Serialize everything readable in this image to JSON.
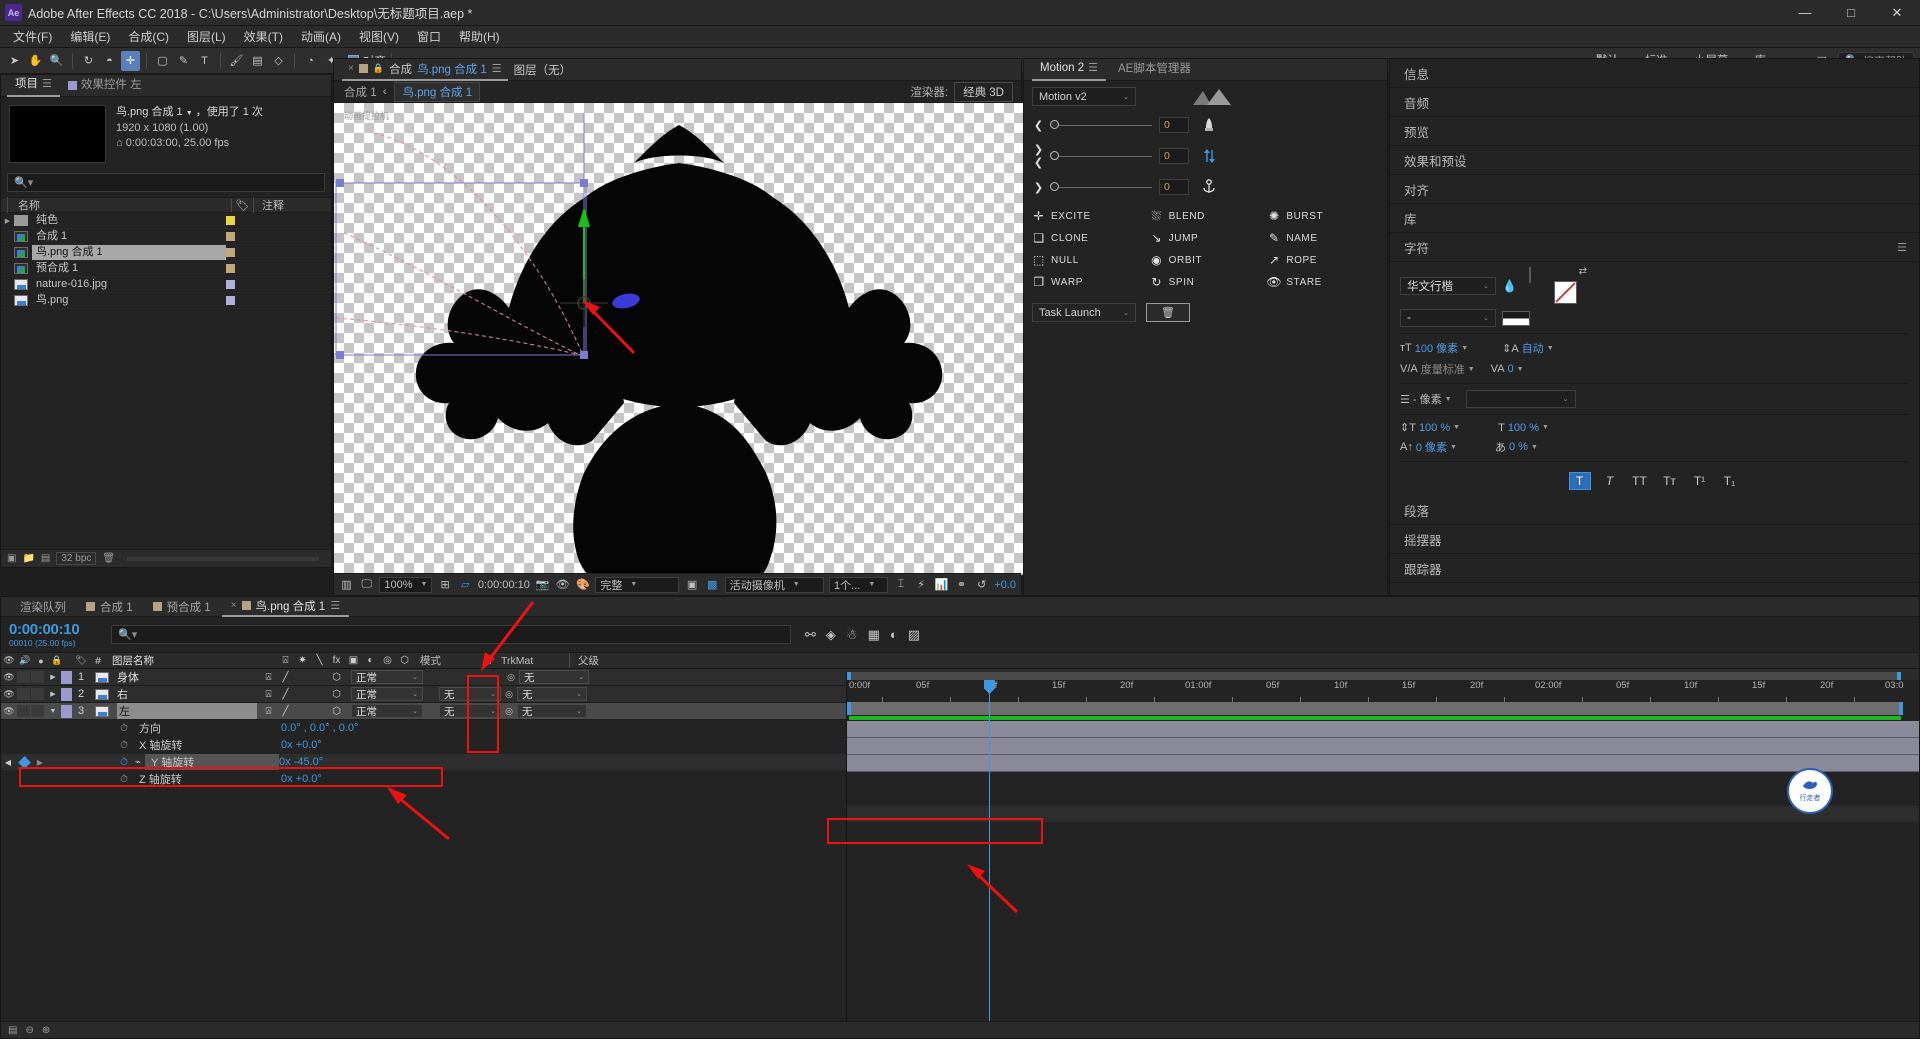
{
  "titlebar": {
    "logo": "Ae",
    "title": "Adobe After Effects CC 2018 - C:\\Users\\Administrator\\Desktop\\无标题项目.aep *",
    "minimize": "—",
    "maximize": "□",
    "close": "✕"
  },
  "menubar": {
    "items": [
      "文件(F)",
      "编辑(E)",
      "合成(C)",
      "图层(L)",
      "效果(T)",
      "动画(A)",
      "视图(V)",
      "窗口",
      "帮助(H)"
    ]
  },
  "toolbar": {
    "snap_label": "对齐",
    "workspaces": [
      "默认",
      "标准",
      "小屏幕",
      "库"
    ],
    "workspace_more": "»",
    "search_placeholder": "搜索帮助",
    "search_icon": "search-icon"
  },
  "project": {
    "tabs": [
      {
        "label": "项目",
        "active": true
      },
      {
        "label": "效果控件 左",
        "active": false
      }
    ],
    "info": {
      "name": "鸟.png 合成 1",
      "usage": "，使用了 1 次",
      "dimensions": "1920 x 1080 (1.00)",
      "duration": "0:00:03:00, 25.00 fps"
    },
    "search_placeholder": "",
    "columns": [
      "名称",
      "注释"
    ],
    "items": [
      {
        "name": "纯色",
        "type": "folder",
        "color": "#e8d64a",
        "expandable": true,
        "selected": false
      },
      {
        "name": "合成 1",
        "type": "comp",
        "color": "#c0a878",
        "expandable": false,
        "selected": false
      },
      {
        "name": "鸟.png 合成 1",
        "type": "comp",
        "color": "#c0a878",
        "expandable": false,
        "selected": true
      },
      {
        "name": "预合成 1",
        "type": "comp",
        "color": "#c0a878",
        "expandable": false,
        "selected": false
      },
      {
        "name": "nature-016.jpg",
        "type": "image",
        "color": "#b0b0d8",
        "expandable": false,
        "selected": false
      },
      {
        "name": "鸟.png",
        "type": "image",
        "color": "#b0b0d8",
        "expandable": false,
        "selected": false
      }
    ],
    "footer": {
      "bpc": "32 bpc"
    }
  },
  "composition": {
    "tabs": [
      {
        "prefix": "合成",
        "name": "鸟.png 合成 1",
        "active": true
      },
      {
        "prefix": "",
        "name": "图层（无）",
        "active": false
      }
    ],
    "breadcrumb_root": "合成 1",
    "breadcrumb_sep": "‹",
    "breadcrumb_current": "鸟.png 合成 1",
    "renderer_label": "渲染器:",
    "renderer_value": "经典 3D",
    "overlay_text": "动画提拉机",
    "bottom": {
      "zoom": "100%",
      "time": "0:00:00:10",
      "quality": "完整",
      "camera": "活动摄像机",
      "views": "1个...",
      "exposure": "+0.0"
    }
  },
  "motion": {
    "tabs": [
      {
        "label": "Motion 2",
        "active": true
      },
      {
        "label": "AE脚本管理器",
        "active": false
      }
    ],
    "preset": "Motion v2",
    "sliders": [
      {
        "icon": "chevron-left-icon",
        "value": "0"
      },
      {
        "icon": "collapse-horizontal-icon",
        "value": "0"
      },
      {
        "icon": "chevron-right-icon",
        "value": "0"
      }
    ],
    "side_icons": [
      "rocket-icon",
      "vertical-arrows-icon",
      "anchor-icon"
    ],
    "buttons": [
      {
        "label": "EXCITE",
        "icon": "plus-icon"
      },
      {
        "label": "BLEND",
        "icon": "blend-icon"
      },
      {
        "label": "BURST",
        "icon": "burst-icon"
      },
      {
        "label": "CLONE",
        "icon": "clone-icon"
      },
      {
        "label": "JUMP",
        "icon": "jump-icon"
      },
      {
        "label": "NAME",
        "icon": "pencil-icon"
      },
      {
        "label": "NULL",
        "icon": "null-icon"
      },
      {
        "label": "ORBIT",
        "icon": "orbit-icon"
      },
      {
        "label": "ROPE",
        "icon": "rope-icon"
      },
      {
        "label": "WARP",
        "icon": "warp-icon"
      },
      {
        "label": "SPIN",
        "icon": "spin-icon"
      },
      {
        "label": "STARE",
        "icon": "eye-icon"
      }
    ],
    "task_launch": "Task Launch",
    "trash_icon": "trash-icon"
  },
  "right_stack": {
    "sections": [
      "信息",
      "音频",
      "预览",
      "效果和预设",
      "对齐",
      "库"
    ],
    "character": {
      "title": "字符",
      "font_family": "华文行楷",
      "font_style": "-",
      "font_size": "100 像素",
      "leading": "自动",
      "kerning_label": "度量标准",
      "tracking": "0",
      "stroke_width": "- 像素",
      "stroke_style": "",
      "vertical_scale": "100 %",
      "horizontal_scale": "100 %",
      "baseline_shift": "0 像素",
      "tsume": "0 %",
      "style_buttons": [
        "T",
        "T",
        "TT",
        "Tт",
        "T¹",
        "T₁"
      ]
    },
    "bottom_sections": [
      "段落",
      "摇摆器",
      "跟踪器"
    ]
  },
  "timeline": {
    "tabs": [
      {
        "label": "渲染队列",
        "active": false,
        "tag": false
      },
      {
        "label": "合成 1",
        "active": false,
        "tag": true
      },
      {
        "label": "预合成 1",
        "active": false,
        "tag": true
      },
      {
        "label": "鸟.png 合成 1",
        "active": true,
        "tag": true
      }
    ],
    "current_time": "0:00:00:10",
    "frame_info": "00010 (25.00 fps)",
    "search_placeholder": "",
    "columns": {
      "num": "#",
      "layer_name": "图层名称",
      "mode": "模式",
      "t": "T",
      "trkmat": "TrkMat",
      "parent": "父级"
    },
    "layers": [
      {
        "num": "1",
        "name": "身体",
        "mode": "正常",
        "trkmat": "",
        "parent": "无",
        "expanded": false,
        "selected": false
      },
      {
        "num": "2",
        "name": "右",
        "mode": "正常",
        "trkmat": "无",
        "parent": "无",
        "expanded": false,
        "selected": false
      },
      {
        "num": "3",
        "name": "左",
        "mode": "正常",
        "trkmat": "无",
        "parent": "无",
        "expanded": true,
        "selected": true
      }
    ],
    "properties": [
      {
        "name": "方向",
        "value": "0.0° , 0.0° , 0.0°",
        "keyed": false,
        "highlighted": false
      },
      {
        "name": "X 轴旋转",
        "value": "0x +0.0°",
        "keyed": false,
        "highlighted": false
      },
      {
        "name": "Y 轴旋转",
        "value": "0x -45.0°",
        "keyed": true,
        "highlighted": true
      },
      {
        "name": "Z 轴旋转",
        "value": "0x +0.0°",
        "keyed": false,
        "highlighted": false
      }
    ],
    "ruler_ticks": [
      "0:00f",
      "05f",
      "10f",
      "15f",
      "20f",
      "01:00f",
      "05f",
      "10f",
      "15f",
      "20f",
      "02:00f",
      "05f",
      "10f",
      "15f",
      "20f",
      "03:0"
    ],
    "badge_text": "行走者"
  }
}
